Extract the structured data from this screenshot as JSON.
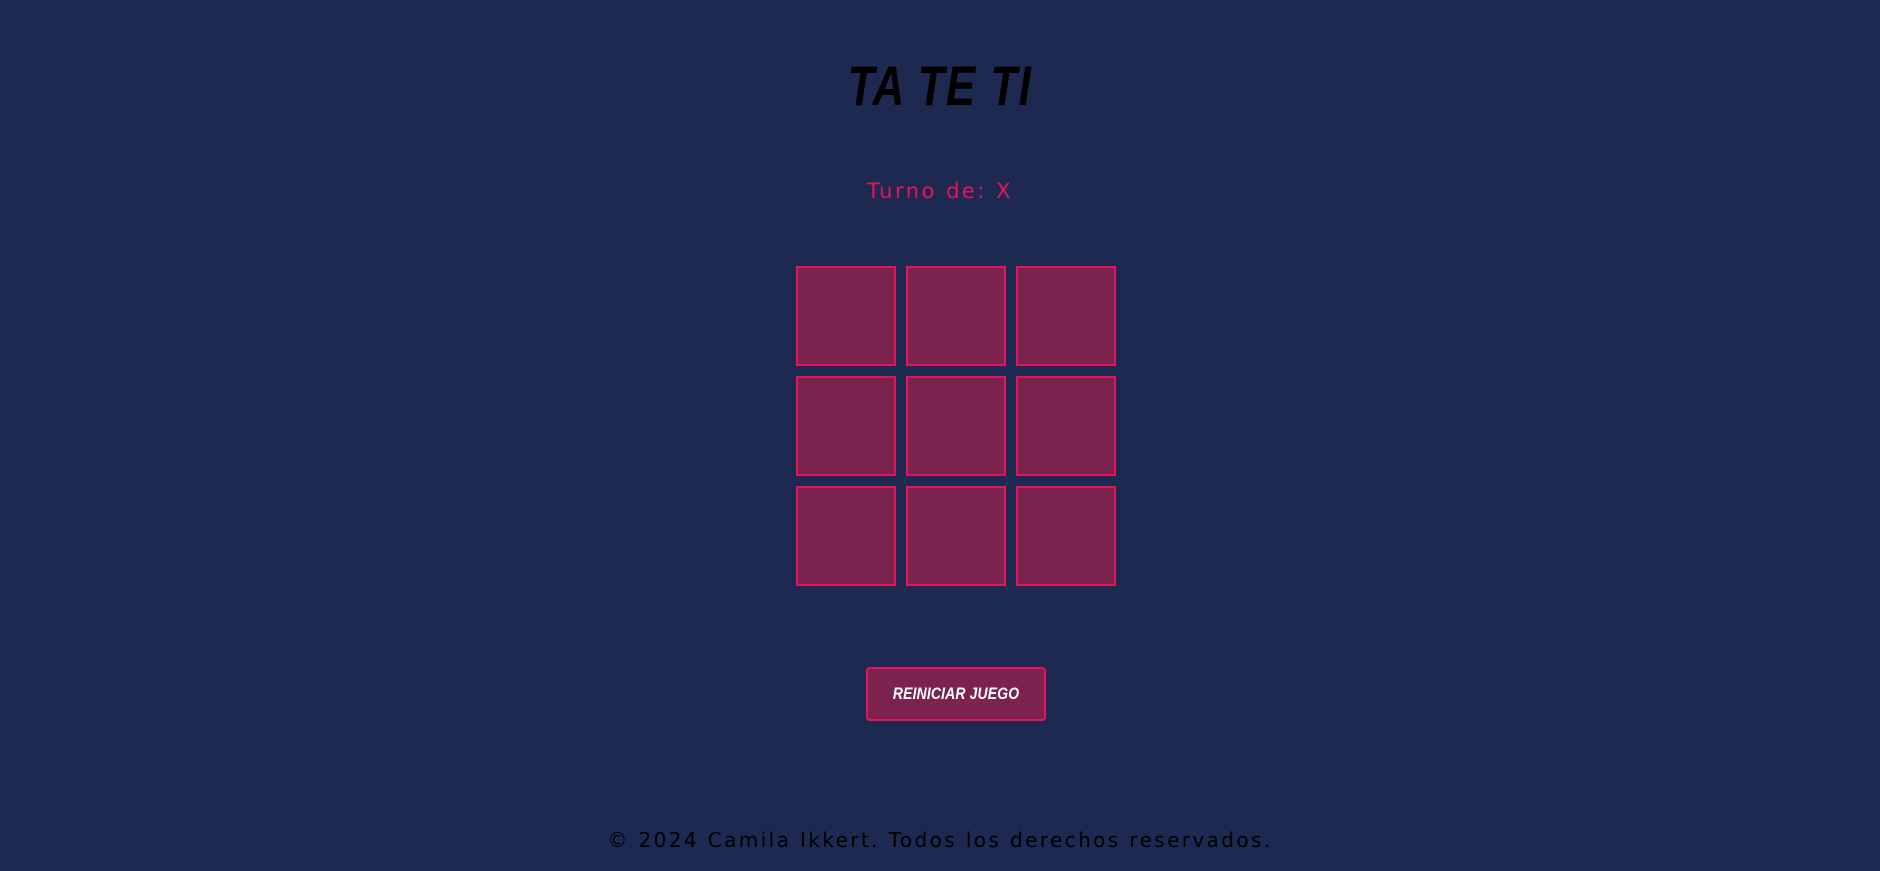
{
  "header": {
    "title": "TA TE TI"
  },
  "status": {
    "turn_text": "Turno de: X"
  },
  "board": {
    "cells": [
      "",
      "",
      "",
      "",
      "",
      "",
      "",
      "",
      ""
    ]
  },
  "controls": {
    "reset_label": "Reiniciar juego"
  },
  "footer": {
    "text": "© 2024 Camila Ikkert. Todos los derechos reservados."
  },
  "colors": {
    "background": "#1d2951",
    "accent": "#e8145a",
    "cell_fill": "#7b224f"
  }
}
